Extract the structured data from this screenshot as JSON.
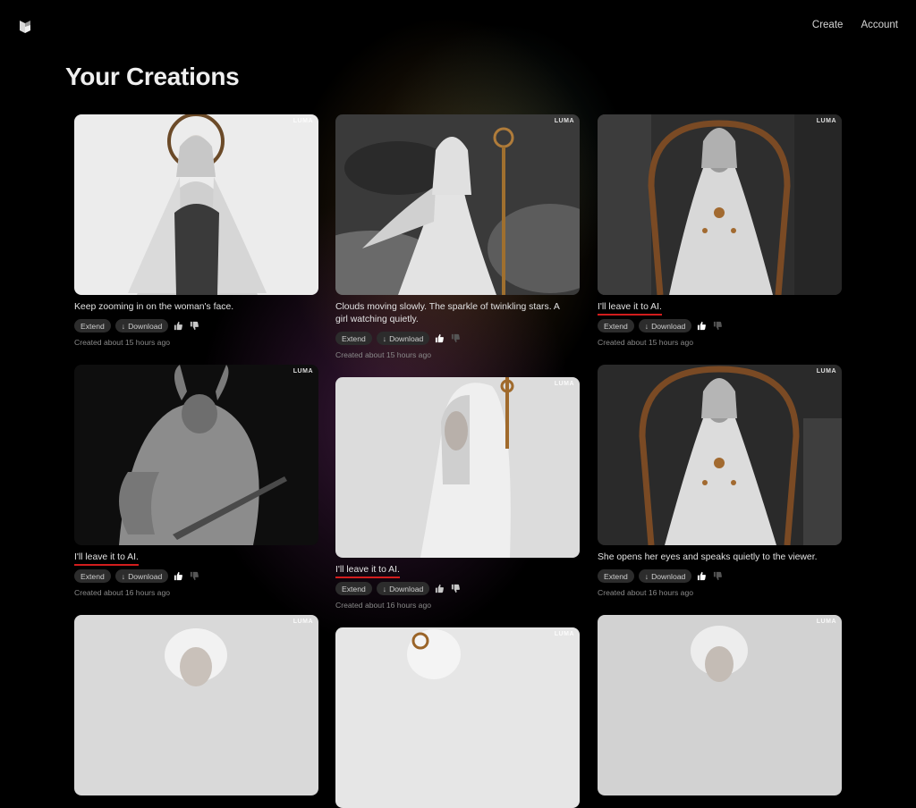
{
  "header": {
    "nav": [
      {
        "label": "Create"
      },
      {
        "label": "Account"
      }
    ]
  },
  "page": {
    "title": "Your Creations"
  },
  "common": {
    "extend_label": "Extend",
    "download_label": "Download",
    "watermark": "LUMA"
  },
  "cards": [
    {
      "caption": "Keep zooming in on the woman's face.",
      "created": "Created about 15 hours ago"
    },
    {
      "caption": "Clouds moving slowly. The sparkle of twinkling stars. A girl watching quietly.",
      "created": "Created about 15 hours ago"
    },
    {
      "caption": "I'll leave it to AI.",
      "created": "Created about 15 hours ago"
    },
    {
      "caption": "I'll leave it to AI.",
      "created": "Created about 16 hours ago"
    },
    {
      "caption": "I'll leave it to AI.",
      "created": "Created about 16 hours ago"
    },
    {
      "caption": "She opens her eyes and speaks quietly to the viewer.",
      "created": "Created about 16 hours ago"
    }
  ],
  "theme": {
    "accent_underline": "#d21d1d",
    "button_bg": "#2c2c2c"
  }
}
